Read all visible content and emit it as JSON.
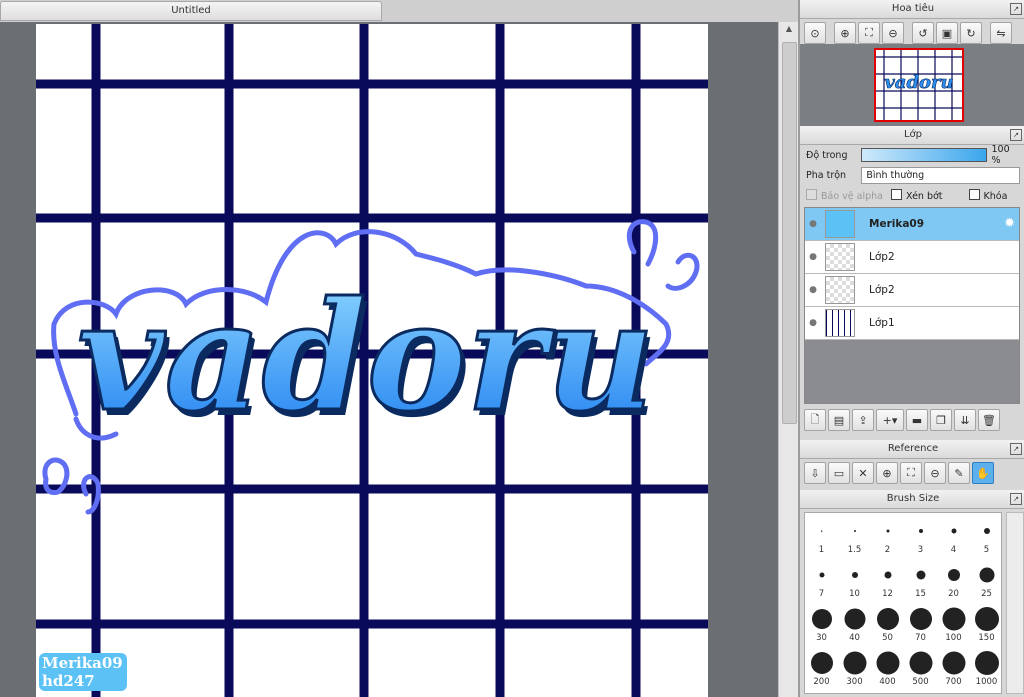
{
  "document_tab": {
    "title": "Untitled"
  },
  "navigator": {
    "title": "Hoa tiêu",
    "tools": [
      "zoom-actual-icon",
      "zoom-in-icon",
      "fit-icon",
      "zoom-out-icon",
      "rotate-ccw-icon",
      "reset-rotation-icon",
      "rotate-cw-icon",
      "flip-icon"
    ]
  },
  "layers": {
    "title": "Lớp",
    "opacity_label": "Độ trong",
    "opacity_value": "100 %",
    "opacity_level": 1.0,
    "blend_label": "Pha trộn",
    "blend_value": "Bình thường",
    "protect_alpha_label": "Bảo vệ alpha",
    "clipping_label": "Xén bớt",
    "lock_label": "Khóa",
    "items": [
      {
        "name": "Merika09",
        "selected": true
      },
      {
        "name": "Lớp2",
        "selected": false
      },
      {
        "name": "Lớp2",
        "selected": false
      },
      {
        "name": "Lớp1",
        "selected": false
      }
    ]
  },
  "reference": {
    "title": "Reference"
  },
  "brush_size": {
    "title": "Brush Size",
    "sizes": [
      "1",
      "1.5",
      "2",
      "3",
      "4",
      "5",
      "7",
      "10",
      "12",
      "15",
      "20",
      "25",
      "30",
      "40",
      "50",
      "70",
      "100",
      "150",
      "200",
      "300",
      "400",
      "500",
      "700",
      "1000"
    ]
  },
  "artwork": {
    "lettering": "vadoru",
    "watermark_line1": "Merika09",
    "watermark_line2": "hd247"
  },
  "colors": {
    "grid": "#0a0a5a",
    "letter_top": "#8fd8ff",
    "letter_bottom": "#1f7ff0",
    "outline": "#5f6ef2",
    "selection": "#7fc8f4"
  }
}
